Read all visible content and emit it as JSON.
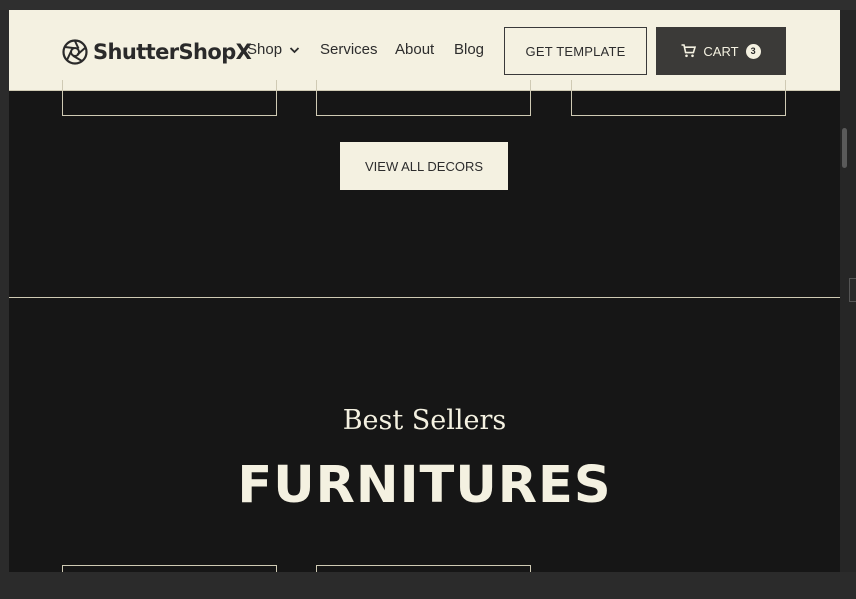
{
  "header": {
    "brand": "ShutterShopX",
    "nav": {
      "shop": "Shop",
      "services": "Services",
      "about": "About",
      "blog": "Blog"
    },
    "get_template": "GET TEMPLATE",
    "cart_label": "CART",
    "cart_count": "3"
  },
  "decors": {
    "view_all": "VIEW ALL DECORS"
  },
  "best_sellers": {
    "eyebrow": "Best Sellers",
    "heading": "FURNITURES"
  },
  "colors": {
    "cream": "#f4f1e1",
    "background": "#161616",
    "dark_button": "#3b3a38"
  },
  "icons": {
    "logo": "shutter-aperture-icon",
    "shop_dropdown": "chevron-down-icon",
    "cart": "cart-icon"
  }
}
